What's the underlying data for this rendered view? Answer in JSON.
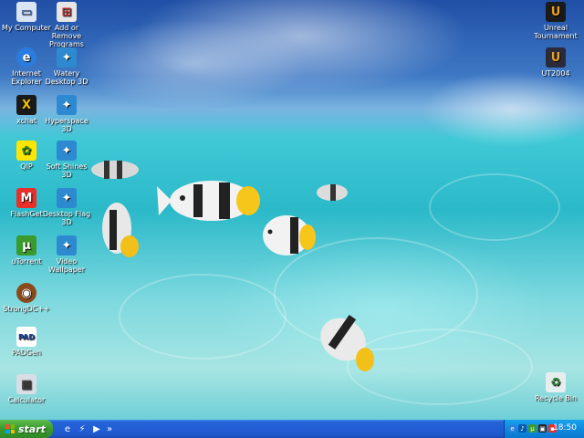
{
  "desktop": {
    "icons_left": [
      {
        "label": "My Computer",
        "icon": "computer-icon"
      },
      {
        "label": "Internet Explorer",
        "icon": "ie-icon"
      },
      {
        "label": "xchat",
        "icon": "xchat-icon"
      },
      {
        "label": "QIP",
        "icon": "qip-icon"
      },
      {
        "label": "FlashGet",
        "icon": "flashget-icon"
      },
      {
        "label": "uTorrent",
        "icon": "utorrent-icon"
      },
      {
        "label": "StrongDC++",
        "icon": "strongdc-icon"
      },
      {
        "label": "PADGen",
        "icon": "padgen-icon"
      },
      {
        "label": "Calculator",
        "icon": "calculator-icon"
      }
    ],
    "icons_second": [
      {
        "label": "Add or Remove Programs",
        "icon": "add-remove-icon"
      },
      {
        "label": "Watery Desktop 3D",
        "icon": "screensaver-icon"
      },
      {
        "label": "Hyperspace 3D",
        "icon": "screensaver-icon"
      },
      {
        "label": "Soft Shines 3D",
        "icon": "screensaver-icon"
      },
      {
        "label": "Desktop Flag 3D",
        "icon": "screensaver-icon"
      },
      {
        "label": "Video Wallpaper",
        "icon": "screensaver-icon"
      }
    ],
    "icons_right": [
      {
        "label": "Unreal Tournament",
        "icon": "unreal-icon"
      },
      {
        "label": "UT2004",
        "icon": "ut2004-icon"
      },
      {
        "label": "Recycle Bin",
        "icon": "recycle-bin-icon"
      }
    ]
  },
  "taskbar": {
    "start_label": "start",
    "clock": "18:50",
    "quick_launch": [
      "ie-icon",
      "flashget-icon",
      "media-icon"
    ],
    "overflow": "»"
  },
  "colors": {
    "taskbar": "#225ed6",
    "start": "#3a9a2e",
    "tray": "#0f8ae0"
  }
}
